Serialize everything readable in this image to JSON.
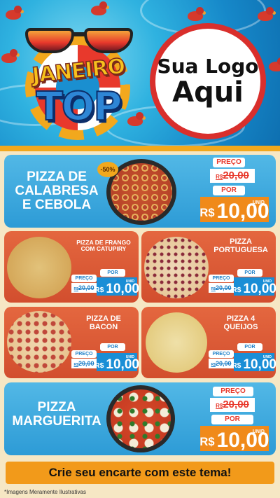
{
  "hero": {
    "badge_line1": "JANEIRO",
    "badge_line2": "TOP",
    "logo_line1": "Sua Logo",
    "logo_line2": "Aqui"
  },
  "featured": [
    {
      "name": "PIZZA DE CALABRESA E CEBOLA",
      "discount": "-50%",
      "old_label": "PREÇO",
      "old_currency": "R$",
      "old_price": "20,00",
      "new_label": "POR",
      "new_currency": "R$",
      "new_price": "10,00",
      "unit": "UNID"
    },
    {
      "name": "PIZZA MARGUERITA",
      "old_label": "PREÇO",
      "old_currency": "R$",
      "old_price": "20,00",
      "new_label": "POR",
      "new_currency": "R$",
      "new_price": "10,00",
      "unit": "UNID"
    }
  ],
  "grid": [
    {
      "name": "PIZZA DE FRANGO COM CATUPIRY",
      "old_label": "PREÇO",
      "old_currency": "R$",
      "old_price": "20,00",
      "new_label": "POR",
      "new_currency": "R$",
      "new_price": "10,00",
      "unit": "UNID"
    },
    {
      "name": "PIZZA PORTUGUESA",
      "old_label": "PREÇO",
      "old_currency": "R$",
      "old_price": "20,00",
      "new_label": "POR",
      "new_currency": "R$",
      "new_price": "10,00",
      "unit": "UNID"
    },
    {
      "name": "PIZZA DE BACON",
      "old_label": "PREÇO",
      "old_currency": "R$",
      "old_price": "20,00",
      "new_label": "POR",
      "new_currency": "R$",
      "new_price": "10,00",
      "unit": "UNID"
    },
    {
      "name": "PIZZA 4 QUEIJOS",
      "old_label": "PREÇO",
      "old_currency": "R$",
      "old_price": "20,00",
      "new_label": "POR",
      "new_currency": "R$",
      "new_price": "10,00",
      "unit": "UNID"
    }
  ],
  "cta": "Crie seu encarte com este tema!",
  "footer_note": "*Imagens Meramente Ilustrativas",
  "colors": {
    "blue_card": "#2d9bd6",
    "red_card": "#d24e2e",
    "accent_orange": "#f08a1a",
    "accent_red": "#e8392c"
  }
}
